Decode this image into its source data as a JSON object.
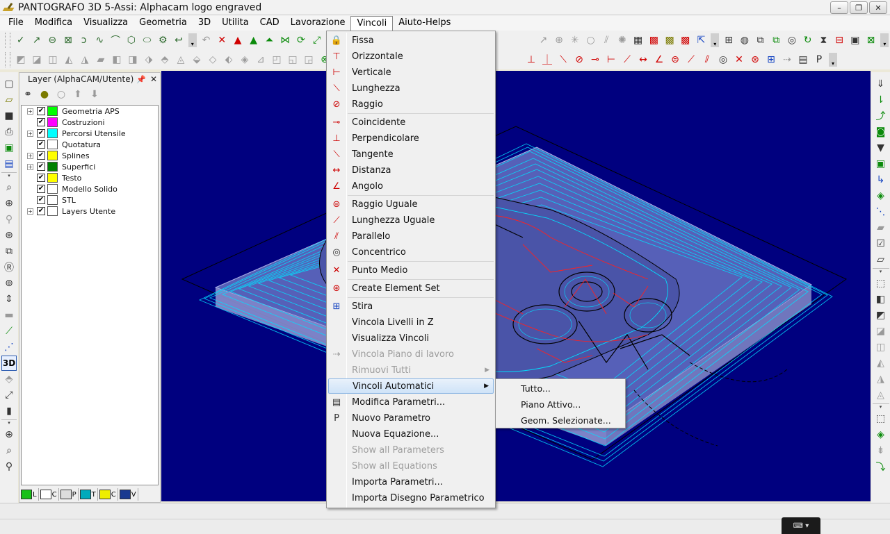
{
  "window": {
    "title": "PANTOGRAFO 3D 5-Assi: Alphacam logo engraved",
    "minimize_label": "–",
    "restore_label": "❐",
    "close_label": "✕"
  },
  "menubar": {
    "items": [
      "File",
      "Modifica",
      "Visualizza",
      "Geometria",
      "3D",
      "Utilita",
      "CAD",
      "Lavorazione",
      "Vincoli",
      "Aiuto-Helps"
    ],
    "active": "Vincoli"
  },
  "layer_panel": {
    "title": "Layer (AlphaCAM/Utente)",
    "pin_icon": "pin-icon",
    "close_label": "✕",
    "layers": [
      {
        "name": "Geometria APS",
        "color": "#00ff00",
        "expandable": true
      },
      {
        "name": "Costruzioni",
        "color": "#ff00ff",
        "expandable": false
      },
      {
        "name": "Percorsi Utensile",
        "color": "#00ffff",
        "expandable": true
      },
      {
        "name": "Quotatura",
        "color": "#ffffff",
        "expandable": false
      },
      {
        "name": "Splines",
        "color": "#ffff00",
        "expandable": true
      },
      {
        "name": "Superfici",
        "color": "#008000",
        "expandable": true
      },
      {
        "name": "Testo",
        "color": "#ffff00",
        "expandable": false
      },
      {
        "name": "Modello Solido",
        "color": "#ffffff",
        "expandable": false
      },
      {
        "name": "STL",
        "color": "#ffffff",
        "expandable": false
      },
      {
        "name": "Layers Utente",
        "color": "#ffffff",
        "expandable": true
      }
    ],
    "tabs": [
      "L",
      "C",
      "P",
      "T",
      "C",
      "V"
    ]
  },
  "vincoli_menu": {
    "items": [
      {
        "label": "Fissa",
        "icon": "lock-icon",
        "disabled": false
      },
      {
        "label": "Orizzontale",
        "icon": "horizontal-icon",
        "disabled": false
      },
      {
        "label": "Verticale",
        "icon": "vertical-icon",
        "disabled": false
      },
      {
        "label": "Lunghezza",
        "icon": "length-icon",
        "disabled": false
      },
      {
        "label": "Raggio",
        "icon": "radius-icon",
        "disabled": false
      },
      {
        "separator": true
      },
      {
        "label": "Coincidente",
        "icon": "coincident-icon",
        "disabled": false
      },
      {
        "label": "Perpendicolare",
        "icon": "perpendicular-icon",
        "disabled": false
      },
      {
        "label": "Tangente",
        "icon": "tangent-icon",
        "disabled": false
      },
      {
        "label": "Distanza",
        "icon": "distance-icon",
        "disabled": false
      },
      {
        "label": "Angolo",
        "icon": "angle-icon",
        "disabled": false
      },
      {
        "separator": true
      },
      {
        "label": "Raggio Uguale",
        "icon": "equal-radius-icon",
        "disabled": false
      },
      {
        "label": "Lunghezza Uguale",
        "icon": "equal-length-icon",
        "disabled": false
      },
      {
        "label": "Parallelo",
        "icon": "parallel-icon",
        "disabled": false
      },
      {
        "label": "Concentrico",
        "icon": "concentric-icon",
        "disabled": false
      },
      {
        "separator": true
      },
      {
        "label": "Punto Medio",
        "icon": "midpoint-icon",
        "disabled": false
      },
      {
        "separator": true
      },
      {
        "label": "Create Element Set",
        "icon": "element-set-icon",
        "disabled": false
      },
      {
        "separator": true
      },
      {
        "label": "Stira",
        "icon": "stretch-icon",
        "disabled": false
      },
      {
        "label": "Vincola Livelli in Z",
        "icon": "",
        "disabled": false
      },
      {
        "label": "Visualizza Vincoli",
        "icon": "",
        "disabled": false
      },
      {
        "label": "Vincola Piano di lavoro",
        "icon": "workplane-icon",
        "disabled": true
      },
      {
        "label": "Rimuovi Tutti",
        "icon": "",
        "disabled": true,
        "submenu": true
      },
      {
        "label": "Vincoli Automatici",
        "icon": "",
        "disabled": false,
        "submenu": true,
        "highlight": true
      },
      {
        "label": "Modifica Parametri...",
        "icon": "parameters-icon",
        "disabled": false
      },
      {
        "label": "Nuovo Parametro",
        "icon": "new-parameter-icon",
        "disabled": false
      },
      {
        "label": "Nuova Equazione...",
        "icon": "",
        "disabled": false
      },
      {
        "label": "Show all Parameters",
        "icon": "",
        "disabled": true
      },
      {
        "label": "Show all Equations",
        "icon": "",
        "disabled": true
      },
      {
        "label": "Importa Parametri...",
        "icon": "",
        "disabled": false
      },
      {
        "label": "Importa Disegno Parametrico",
        "icon": "",
        "disabled": false
      }
    ]
  },
  "submenu": {
    "items": [
      "Tutto...",
      "Piano Attivo...",
      "Geom. Selezionate..."
    ]
  },
  "colors": {
    "viewport_bg": "#00007f",
    "toolpath": "#00ffff",
    "geometry_red": "#ff0000",
    "highlight": "#cfe3f8"
  }
}
